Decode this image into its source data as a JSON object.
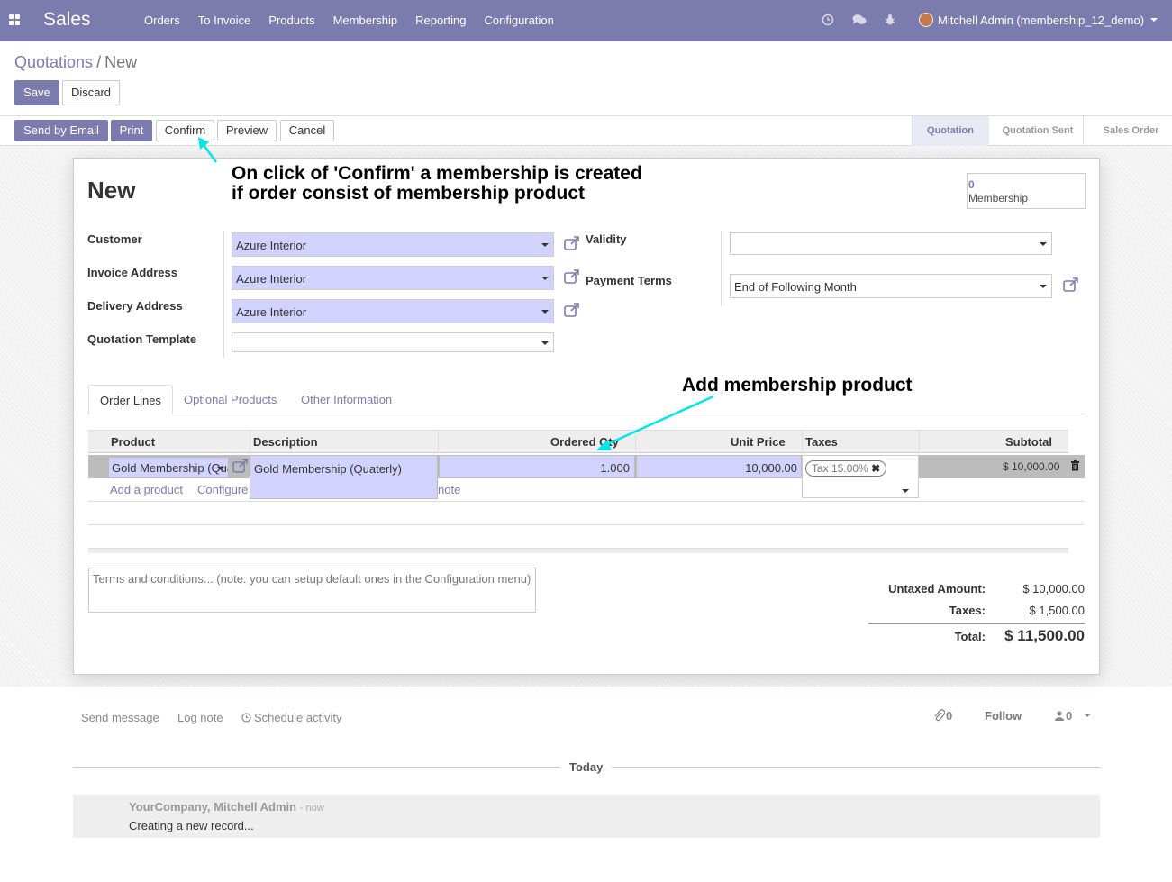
{
  "navbar": {
    "brand": "Sales",
    "menu": [
      "Orders",
      "To Invoice",
      "Products",
      "Membership",
      "Reporting",
      "Configuration"
    ],
    "user": "Mitchell Admin (membership_12_demo)",
    "color": "#7c7bad"
  },
  "breadcrumb": {
    "parent": "Quotations",
    "separator": "/",
    "current": "New"
  },
  "buttons": {
    "save": "Save",
    "discard": "Discard",
    "send_email": "Send by Email",
    "print": "Print",
    "confirm": "Confirm",
    "preview": "Preview",
    "cancel": "Cancel"
  },
  "statusbar": [
    "Quotation",
    "Quotation Sent",
    "Sales Order"
  ],
  "annotations": {
    "confirm_note_line1": "On click of 'Confirm' a membership is created",
    "confirm_note_line2": "if order consist of membership product",
    "product_note": "Add membership product",
    "arrow_color": "#00e5e5"
  },
  "form": {
    "title": "New",
    "smart_button": {
      "count": "0",
      "label": "Membership"
    },
    "customer_label": "Customer",
    "customer": "Azure Interior",
    "invoice_label": "Invoice Address",
    "invoice": "Azure Interior",
    "delivery_label": "Delivery Address",
    "delivery": "Azure Interior",
    "template_label": "Quotation Template",
    "template": "",
    "validity_label": "Validity",
    "validity": "",
    "payment_label": "Payment Terms",
    "payment": "End of Following Month"
  },
  "tabs": [
    "Order Lines",
    "Optional Products",
    "Other Information"
  ],
  "table": {
    "headers": [
      "Product",
      "Description",
      "Ordered Qty",
      "Unit Price",
      "Taxes",
      "Subtotal"
    ],
    "row": {
      "product": "Gold Membership (Quaterly)",
      "description": "Gold Membership (Quaterly)",
      "qty": "1.000",
      "price": "10,000.00",
      "tax": "Tax 15.00%",
      "subtotal": "$ 10,000.00"
    },
    "add_product": "Add a product",
    "configure": "Configure",
    "note": "note"
  },
  "terms_placeholder": "Terms and conditions... (note: you can setup default ones in the Configuration menu)",
  "totals": {
    "untaxed_label": "Untaxed Amount:",
    "untaxed": "$ 10,000.00",
    "taxes_label": "Taxes:",
    "taxes": "$ 1,500.00",
    "total_label": "Total:",
    "total": "$ 11,500.00"
  },
  "chatter": {
    "send_message": "Send message",
    "log_note": "Log note",
    "schedule": "Schedule activity",
    "attachments": "0",
    "follow": "Follow",
    "followers": "0",
    "today": "Today",
    "author": "YourCompany, Mitchell Admin",
    "date": "- now",
    "body": "Creating a new record..."
  }
}
